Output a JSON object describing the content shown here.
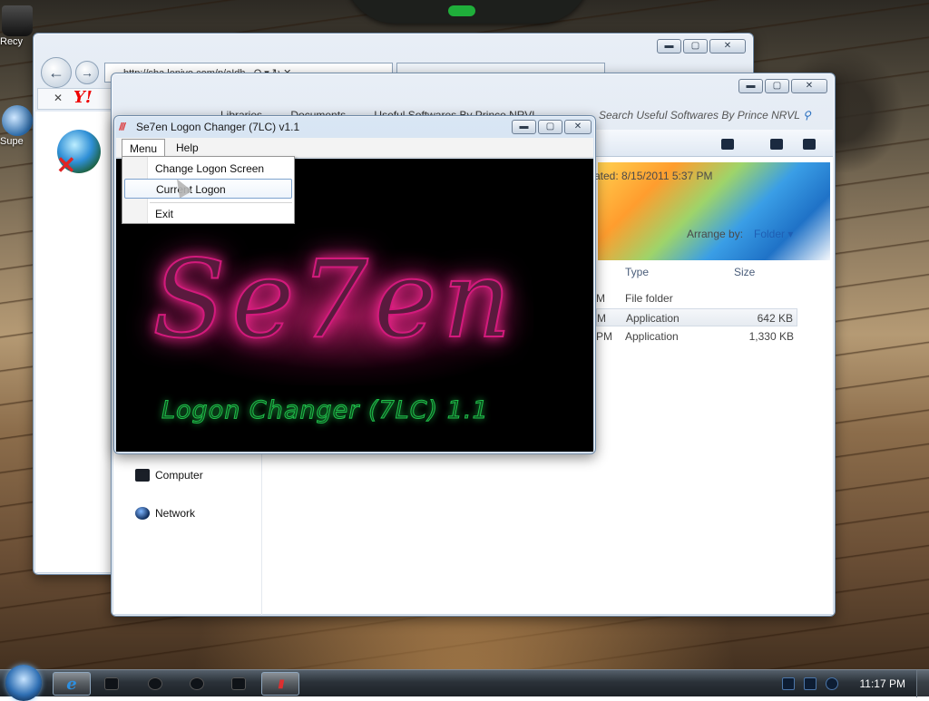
{
  "desktop": {
    "icons": [
      {
        "label": "Recy"
      },
      {
        "label": "Supe"
      }
    ]
  },
  "browser": {
    "address_text": "http://sha.lenivo.com/p/aIdh..  Q ▾ ↻ ✕",
    "toolbar_close": "✕",
    "yahoo_logo": "Y!"
  },
  "explorer": {
    "breadcrumb": [
      "Libraries",
      "Documents",
      "Useful Softwares By Prince NRVL"
    ],
    "search_placeholder": "Search Useful Softwares By Prince NRVL",
    "date_created": "ated: 8/15/2011 5:37 PM",
    "arrange_by_label": "Arrange by:",
    "arrange_by_value": "Folder",
    "columns": {
      "type": "Type",
      "size": "Size"
    },
    "rows": [
      {
        "m": "M",
        "type": "File folder",
        "size": ""
      },
      {
        "m": "M",
        "type": "Application",
        "size": "642 KB"
      },
      {
        "m": "PM",
        "type": "Application",
        "size": "1,330 KB"
      }
    ],
    "nav": {
      "computer": "Computer",
      "network": "Network"
    }
  },
  "app": {
    "title": "Se7en Logon Changer (7LC) v1.1",
    "menu": [
      "Menu",
      "Help"
    ],
    "dropdown": [
      "Change Logon Screen",
      "Current Logon",
      "Exit"
    ],
    "logo_text": "Se7en",
    "sub_text": "Logon Changer (7LC) 1.1"
  },
  "taskbar": {
    "time": "11:17 PM"
  },
  "colors": {
    "glow_pink": "#ff2a97",
    "glow_green": "#1fbf4a",
    "accent_blue": "#1f5fb4"
  }
}
